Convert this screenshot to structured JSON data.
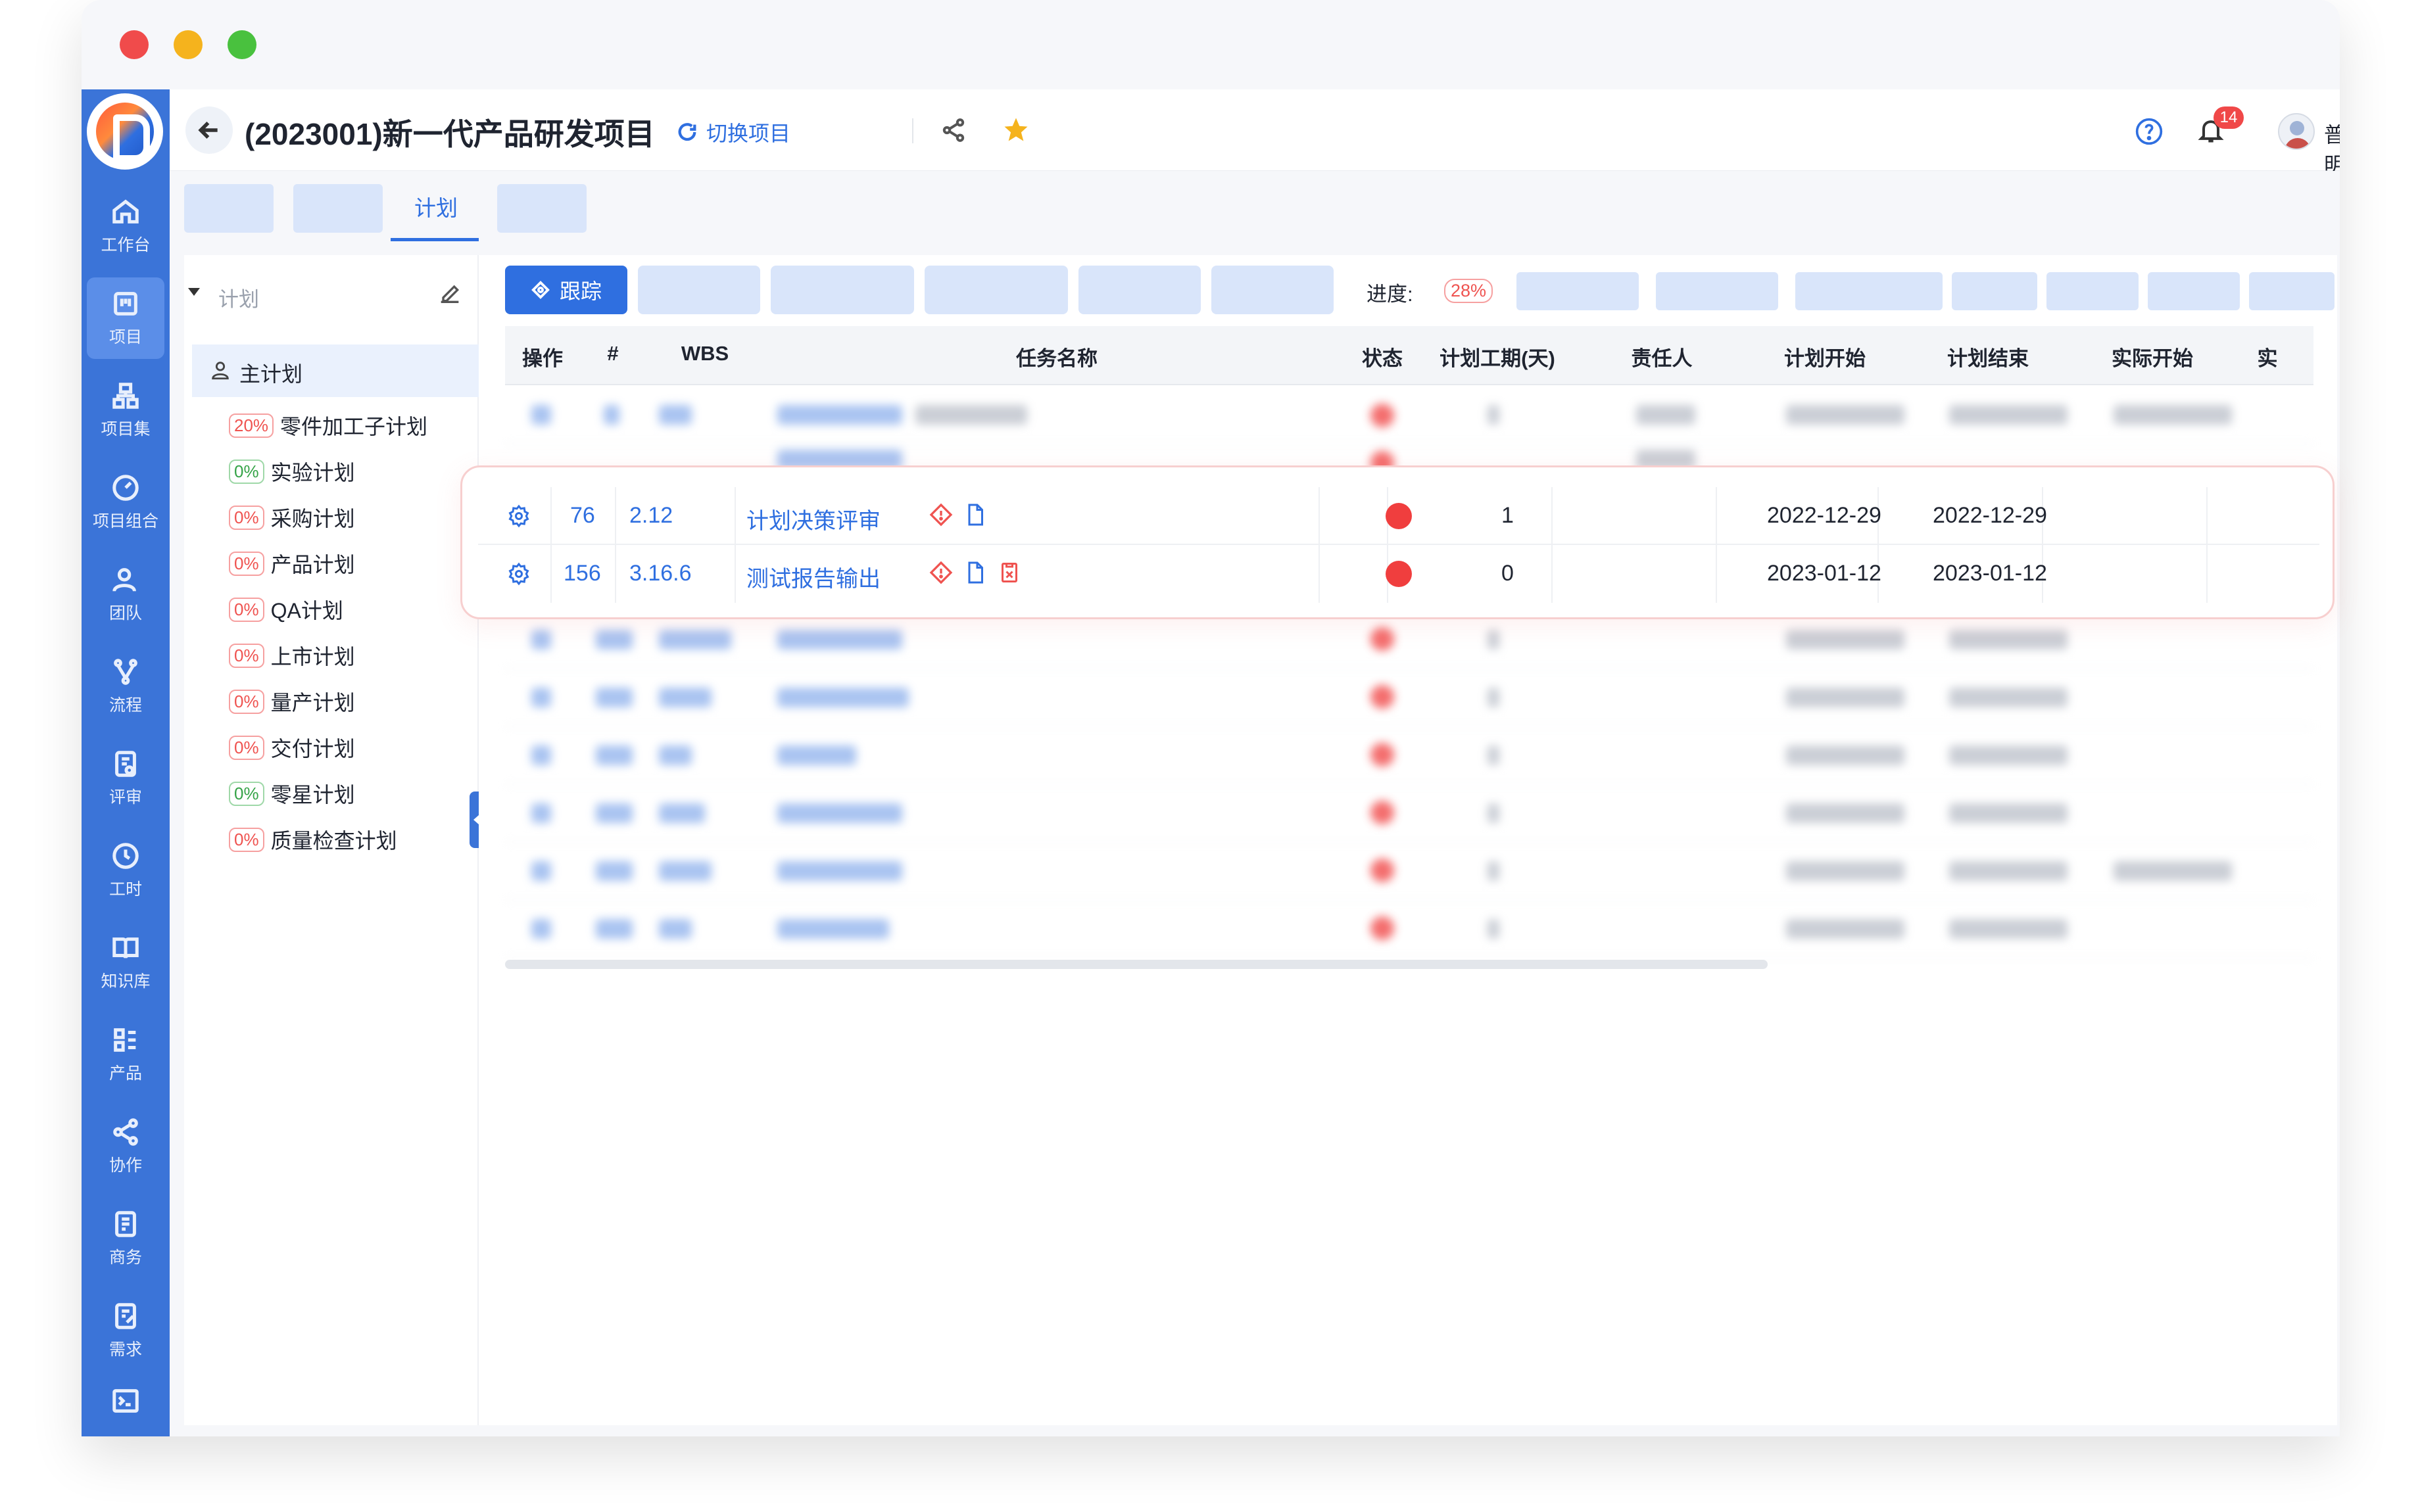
{
  "app": {
    "project_title": "(2023001)新一代产品研发项目",
    "switch_project": "切换项目",
    "notification_count": "14",
    "user_name": "普明"
  },
  "sidebar": {
    "items": [
      {
        "label": "工作台",
        "icon": "home-icon"
      },
      {
        "label": "项目",
        "icon": "kanban-icon",
        "active": true
      },
      {
        "label": "项目集",
        "icon": "hierarchy-icon"
      },
      {
        "label": "项目组合",
        "icon": "dashboard-icon"
      },
      {
        "label": "团队",
        "icon": "team-icon"
      },
      {
        "label": "流程",
        "icon": "flow-icon"
      },
      {
        "label": "评审",
        "icon": "review-icon"
      },
      {
        "label": "工时",
        "icon": "clock-icon"
      },
      {
        "label": "知识库",
        "icon": "book-icon"
      },
      {
        "label": "产品",
        "icon": "product-icon"
      },
      {
        "label": "协作",
        "icon": "share-icon"
      },
      {
        "label": "商务",
        "icon": "business-icon"
      },
      {
        "label": "需求",
        "icon": "requirement-icon"
      },
      {
        "label": "",
        "icon": "terminal-icon"
      }
    ]
  },
  "tabs": {
    "active_label": "计划"
  },
  "plan_tree": {
    "header_label": "计划",
    "main_plan": "主计划",
    "sub_plans": [
      {
        "pct": "20%",
        "label": "零件加工子计划",
        "tone": "red"
      },
      {
        "pct": "0%",
        "label": "实验计划",
        "tone": "green"
      },
      {
        "pct": "0%",
        "label": "采购计划",
        "tone": "red"
      },
      {
        "pct": "0%",
        "label": "产品计划",
        "tone": "red"
      },
      {
        "pct": "0%",
        "label": "QA计划",
        "tone": "red"
      },
      {
        "pct": "0%",
        "label": "上市计划",
        "tone": "red"
      },
      {
        "pct": "0%",
        "label": "量产计划",
        "tone": "red"
      },
      {
        "pct": "0%",
        "label": "交付计划",
        "tone": "red"
      },
      {
        "pct": "0%",
        "label": "零星计划",
        "tone": "green"
      },
      {
        "pct": "0%",
        "label": "质量检查计划",
        "tone": "red"
      }
    ]
  },
  "toolbar": {
    "track_label": "跟踪",
    "progress_label": "进度:",
    "progress_value": "28%"
  },
  "table": {
    "columns": [
      "操作",
      "#",
      "WBS",
      "任务名称",
      "状态",
      "计划工期(天)",
      "责任人",
      "计划开始",
      "计划结束",
      "实际开始",
      "实"
    ],
    "highlighted_rows": [
      {
        "id": "76",
        "wbs": "2.12",
        "name": "计划决策评审",
        "duration": "1",
        "owner": "",
        "plan_start": "2022-12-29",
        "plan_end": "2022-12-29",
        "actual_start": ""
      },
      {
        "id": "156",
        "wbs": "3.16.6",
        "name": "测试报告输出",
        "duration": "0",
        "owner": "",
        "plan_start": "2023-01-12",
        "plan_end": "2023-01-12",
        "actual_start": ""
      }
    ]
  },
  "colors": {
    "brand": "#3b74d8",
    "accent": "#2f6fe0",
    "status_red": "#f03e3e"
  }
}
